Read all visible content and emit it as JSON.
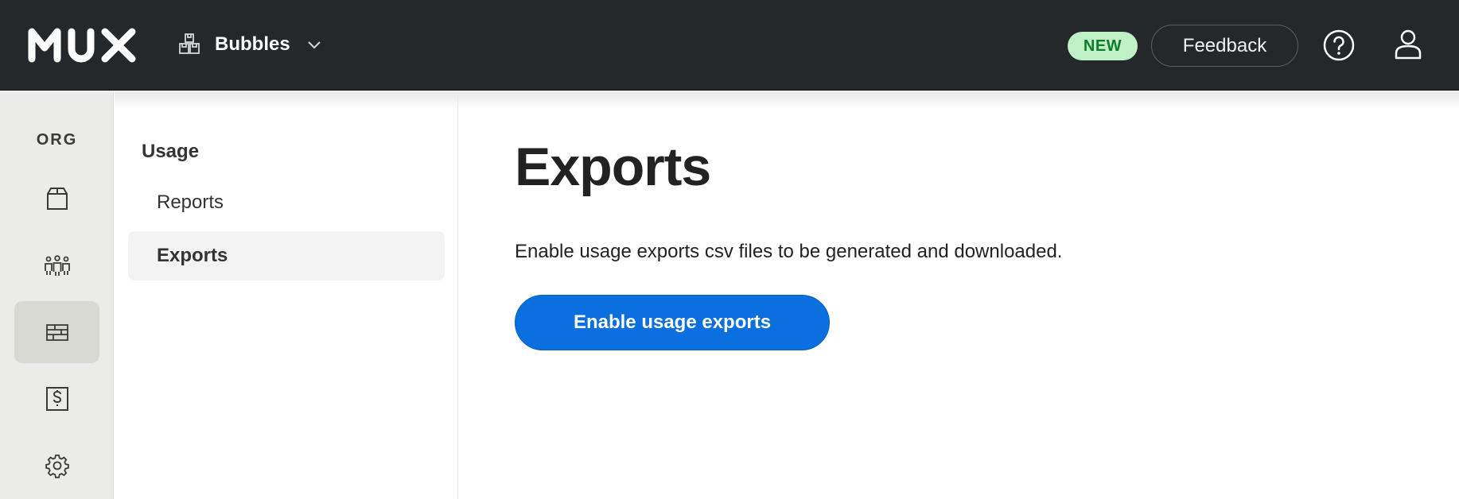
{
  "brand": {
    "logo_text": "MUX"
  },
  "project": {
    "name": "Bubbles"
  },
  "header": {
    "new_badge": "NEW",
    "feedback_label": "Feedback"
  },
  "rail": {
    "label": "ORG",
    "items": [
      {
        "icon": "box-icon"
      },
      {
        "icon": "team-icon"
      },
      {
        "icon": "usage-icon",
        "active": true
      },
      {
        "icon": "billing-icon"
      },
      {
        "icon": "gear-icon"
      }
    ]
  },
  "subnav": {
    "heading": "Usage",
    "items": [
      {
        "label": "Reports"
      },
      {
        "label": "Exports",
        "active": true
      }
    ]
  },
  "main": {
    "title": "Exports",
    "description": "Enable usage exports csv files to be generated and downloaded.",
    "enable_button": "Enable usage exports"
  },
  "colors": {
    "topbar": "#24282b",
    "accent": "#0b6fdf",
    "new_badge_bg": "#bff0c6",
    "new_badge_text": "#127a2c"
  }
}
